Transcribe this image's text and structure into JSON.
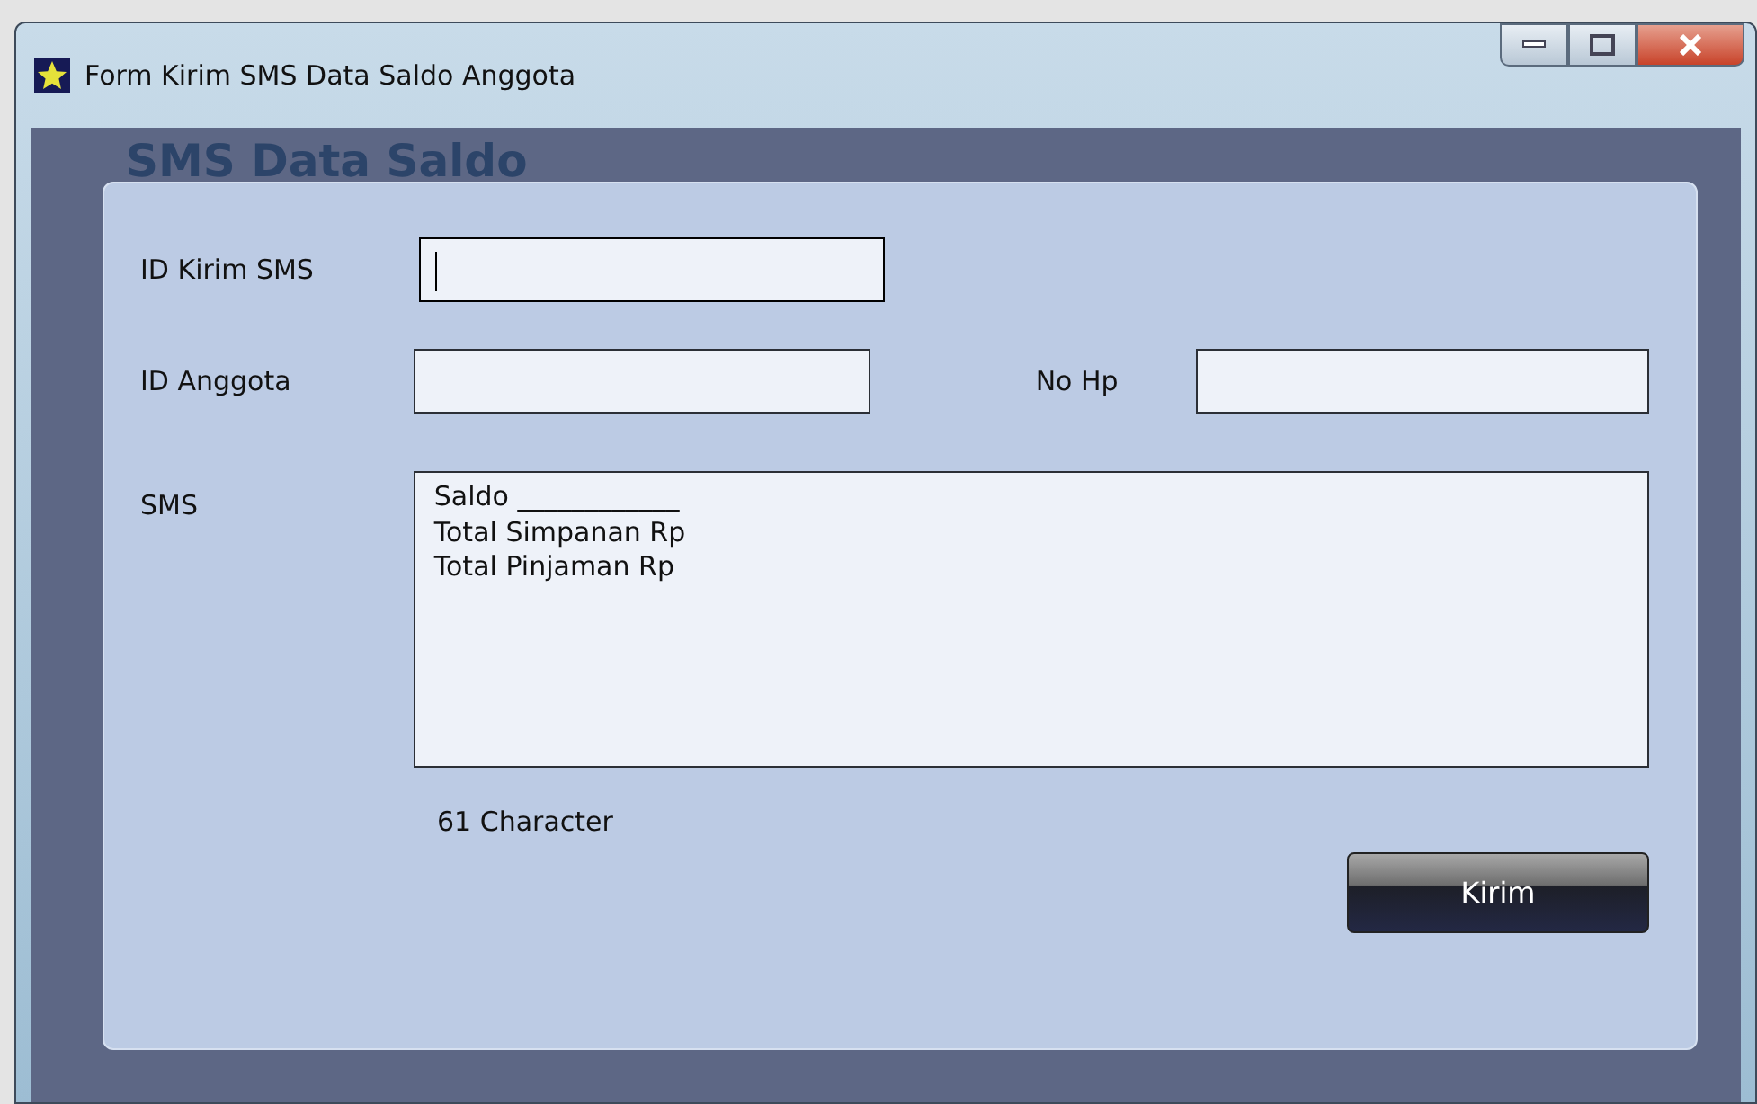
{
  "window": {
    "title": "Form Kirim SMS Data Saldo Anggota"
  },
  "group": {
    "title": "SMS Data Saldo"
  },
  "fields": [
    {
      "label": "ID Kirim SMS",
      "focused": true
    },
    {
      "label": "ID Anggota",
      "focused": false
    },
    {
      "label": "No Hp",
      "focused": false
    }
  ],
  "sms": {
    "label": "SMS",
    "lines": [
      "Saldo ____________",
      "Total Simpanan Rp",
      "Total Pinjaman Rp"
    ]
  },
  "char_count": "61 Character",
  "buttons": [
    "Kirim"
  ]
}
